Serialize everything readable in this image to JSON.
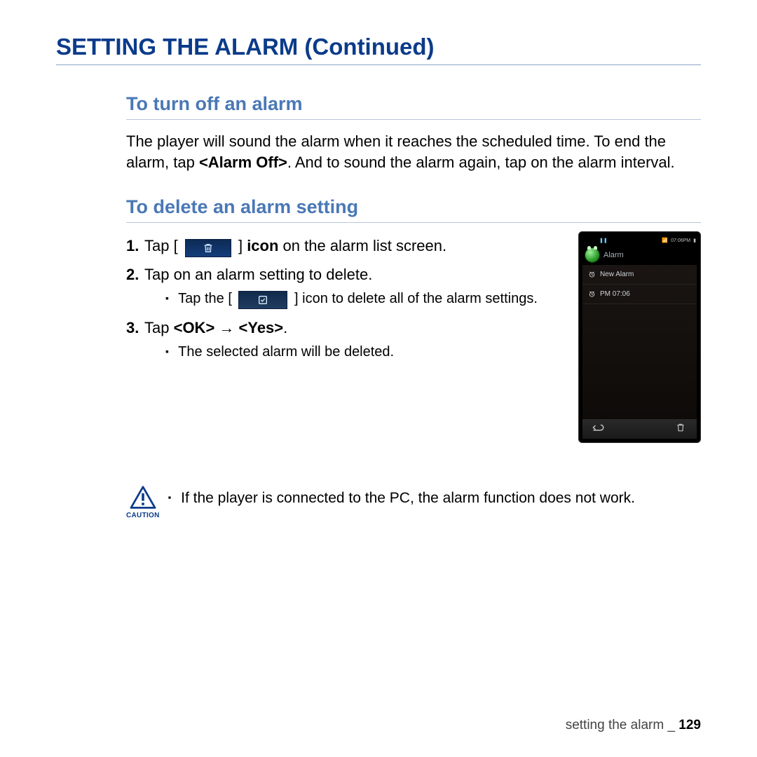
{
  "page_title": "SETTING THE ALARM (Continued)",
  "section1": {
    "title": "To turn off an alarm",
    "body_pre": "The player will sound the alarm when it reaches the scheduled time. To end the alarm, tap ",
    "body_bold": "<Alarm Off>",
    "body_post": ". And to sound the alarm again, tap on the alarm interval."
  },
  "section2": {
    "title": "To delete an alarm setting",
    "step1_pre": "Tap [",
    "step1_post": " ] ",
    "step1_bold": "icon",
    "step1_tail": " on the alarm list screen.",
    "step2": "Tap on an alarm setting to delete.",
    "step2_sub_pre": "Tap the [",
    "step2_sub_post": " ] icon to delete all of the alarm settings.",
    "step3_pre": "Tap ",
    "step3_bold": "<OK> → <Yes>",
    "step3_post": ".",
    "step3_sub": "The selected alarm will be deleted."
  },
  "device": {
    "status_time": "07:06PM",
    "app_title": "Alarm",
    "rows": [
      {
        "label": "New Alarm"
      },
      {
        "label": "PM 07:06"
      }
    ]
  },
  "caution": {
    "label": "CAUTION",
    "text": "If the player is connected to the PC, the alarm function does not work."
  },
  "footer": {
    "section": "setting the alarm",
    "sep": " _ ",
    "page": "129"
  }
}
